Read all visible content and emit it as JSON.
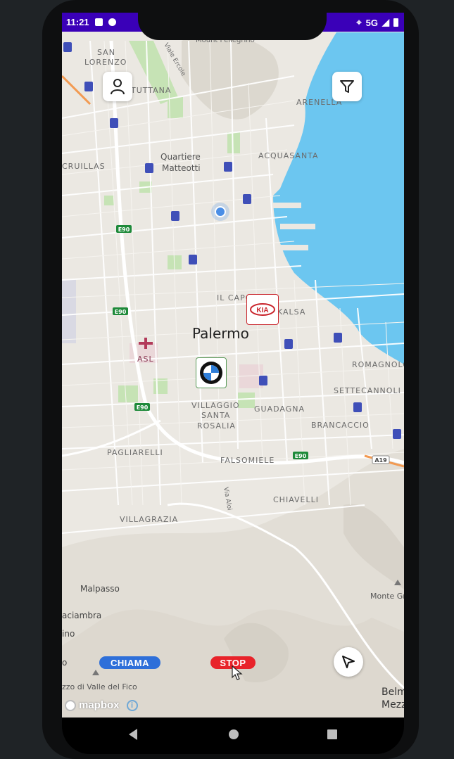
{
  "status_bar": {
    "time": "11:21",
    "network": "5G"
  },
  "map": {
    "city": "Palermo",
    "labels": {
      "mount": "Mount Pellegrino",
      "san_lorenzo_1": "SAN",
      "san_lorenzo_2": "LORENZO",
      "tuttana": "TUTTANA",
      "arenella": "ARENELLA",
      "ercole": "Viale Ercole",
      "quartiere_1": "Quartiere",
      "quartiere_2": "Matteotti",
      "cruillas": "CRUILLAS",
      "acquasanta": "ACQUASANTA",
      "il_capo": "IL CAPO",
      "kalsa": "KALSA",
      "asl": "ASL",
      "romagnolo": "ROMAGNOLO",
      "settecannoli": "SETTECANNOLI",
      "villaggio_1": "VILLAGGIO",
      "villaggio_2": "SANTA",
      "villaggio_3": "ROSALIA",
      "guadagna": "GUADAGNA",
      "brancaccio": "BRANCACCIO",
      "pagliarelli": "PAGLIARELLI",
      "falsomiele": "FALSOMIELE",
      "chiavelli": "CHIAVELLI",
      "via_aloi": "Via Aloi",
      "villagrazia": "VILLAGRAZIA",
      "malpasso": "Malpasso",
      "aciambra": "aciambra",
      "ino": "ino",
      "o": "o",
      "monte_gr": "Monte Gr",
      "palazzo": "zzo di Valle del Fico",
      "belm_1": "Belm",
      "belm_2": "Mezz"
    },
    "road_shields": {
      "e90_a": "E90",
      "e90_b": "E90",
      "e90_c": "E90",
      "e90_d": "E90",
      "a19": "A19"
    }
  },
  "buttons": {
    "chiama": "CHIAMA",
    "stop": "STOP"
  },
  "brands": {
    "kia": "KIA",
    "bmw": "BMW"
  },
  "attribution": "mapbox",
  "colors": {
    "status_bar": "#3a00b8",
    "chiama": "#2e6fd9",
    "stop": "#e8232a",
    "water": "#6cc6f0"
  }
}
